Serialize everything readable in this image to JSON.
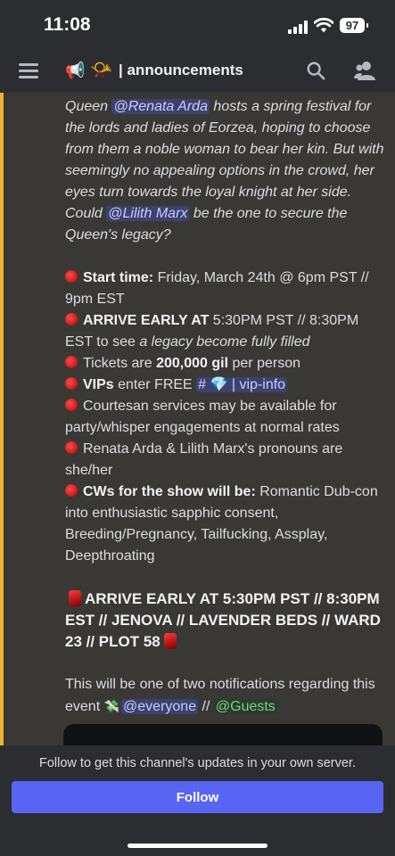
{
  "status_bar": {
    "time": "11:08",
    "battery": "97"
  },
  "header": {
    "channel_emoji": "📯",
    "channel_title": "| announcements",
    "icons": [
      "menu-icon",
      "megaphone-icon",
      "search-icon",
      "members-icon"
    ]
  },
  "message": {
    "intro": {
      "pre": "Queen ",
      "mention1": "@Renata Arda",
      "mid": "  hosts a spring festival for the lords and ladies of Eorzea, hoping to choose from them a noble woman to bear her kin. But with seemingly no appealing options in the crowd, her eyes turn towards the loyal knight at her side. Could ",
      "mention2": "@Lilith Marx",
      "post": " be the one to secure the Queen's legacy?"
    },
    "start": {
      "label": "Start time:",
      "text": " Friday, March 24th @ 6pm PST // 9pm EST"
    },
    "arrive": {
      "label": "ARRIVE EARLY AT",
      "text": " 5:30PM PST // 8:30PM EST to see ",
      "italic": "a legacy become fully filled"
    },
    "tickets": {
      "pre": "Tickets are ",
      "bold": "200,000 gil",
      "post": " per person"
    },
    "vips": {
      "label": "VIPs",
      "text": " enter FREE ",
      "channel": "# 💎 | vip-info"
    },
    "courtesan": "Courtesan services may be available for party/whisper engagements at normal rates",
    "pronouns": "Renata Arda & Lilith Marx's pronouns are she/her",
    "cws": {
      "label": "CWs for the show will be:",
      "text": " Romantic Dub-con into enthusiastic sapphic consent, Breeding/Pregnancy, Tailfucking, Assplay, Deepthroating"
    },
    "arrive_banner": "ARRIVE EARLY AT 5:30PM PST // 8:30PM EST // JENOVA // LAVENDER BEDS // WARD 23 // PLOT 58",
    "footer": {
      "pre": "This will be one of two notifications regarding this event ",
      "emoji": "💸",
      "everyone": "@everyone",
      "sep": " // ",
      "guests": "@Guests"
    }
  },
  "follow_bar": {
    "text": "Follow to get this channel's updates in your own server.",
    "button": "Follow"
  },
  "colors": {
    "accent": "#5865f2",
    "mention_bg": "#3c4270",
    "guests_mention": "#6fd77a",
    "bullet_red": "#e02020"
  }
}
